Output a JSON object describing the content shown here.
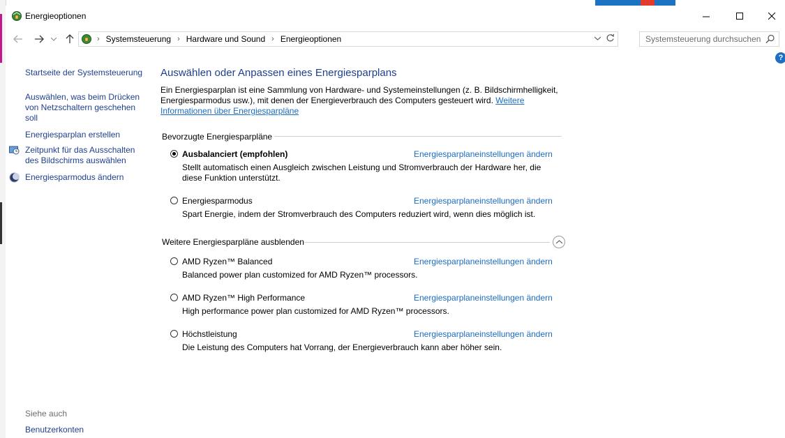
{
  "window": {
    "title": "Energieoptionen"
  },
  "navigation": {
    "breadcrumbs": [
      "Systemsteuerung",
      "Hardware und Sound",
      "Energieoptionen"
    ],
    "search_placeholder": "Systemsteuerung durchsuchen"
  },
  "sidebar": {
    "links": [
      {
        "label": "Startseite der Systemsteuerung"
      },
      {
        "label": "Auswählen, was beim Drücken von Netzschaltern geschehen soll"
      },
      {
        "label": "Energiesparplan erstellen"
      },
      {
        "label": "Zeitpunkt für das Ausschalten des Bildschirms auswählen"
      },
      {
        "label": "Energiesparmodus ändern"
      }
    ],
    "see_also_title": "Siehe auch",
    "see_also_links": [
      {
        "label": "Benutzerkonten"
      }
    ]
  },
  "main": {
    "heading": "Auswählen oder Anpassen eines Energiesparplans",
    "intro_text": "Ein Energiesparplan ist eine Sammlung von Hardware- und Systemeinstellungen (z. B. Bildschirmhelligkeit, Energiesparmodus usw.), mit denen der Energieverbrauch des Computers gesteuert wird.",
    "intro_link": "Weitere Informationen über Energiesparpläne",
    "preferred_title": "Bevorzugte Energiesparpläne",
    "more_title": "Weitere Energiesparpläne ausblenden",
    "change_link_label": "Energiesparplaneinstellungen ändern",
    "preferred_plans": [
      {
        "name": "Ausbalanciert (empfohlen)",
        "selected": true,
        "description": "Stellt automatisch einen Ausgleich zwischen Leistung und Stromverbrauch der Hardware her, die diese Funktion unterstützt."
      },
      {
        "name": "Energiesparmodus",
        "selected": false,
        "description": "Spart Energie, indem der Stromverbrauch des Computers reduziert wird, wenn dies möglich ist."
      }
    ],
    "more_plans": [
      {
        "name": "AMD Ryzen™ Balanced",
        "selected": false,
        "description": "Balanced power plan customized for AMD Ryzen™ processors."
      },
      {
        "name": "AMD Ryzen™ High Performance",
        "selected": false,
        "description": "High performance power plan customized for AMD Ryzen™ processors."
      },
      {
        "name": "Höchstleistung",
        "selected": false,
        "description": "Die Leistung des Computers hat Vorrang, der Energieverbrauch kann aber höher sein."
      }
    ]
  },
  "colors": {
    "link": "#1a6cc4",
    "heading": "#1e3f8f",
    "help_badge": "#1c6fc4"
  }
}
